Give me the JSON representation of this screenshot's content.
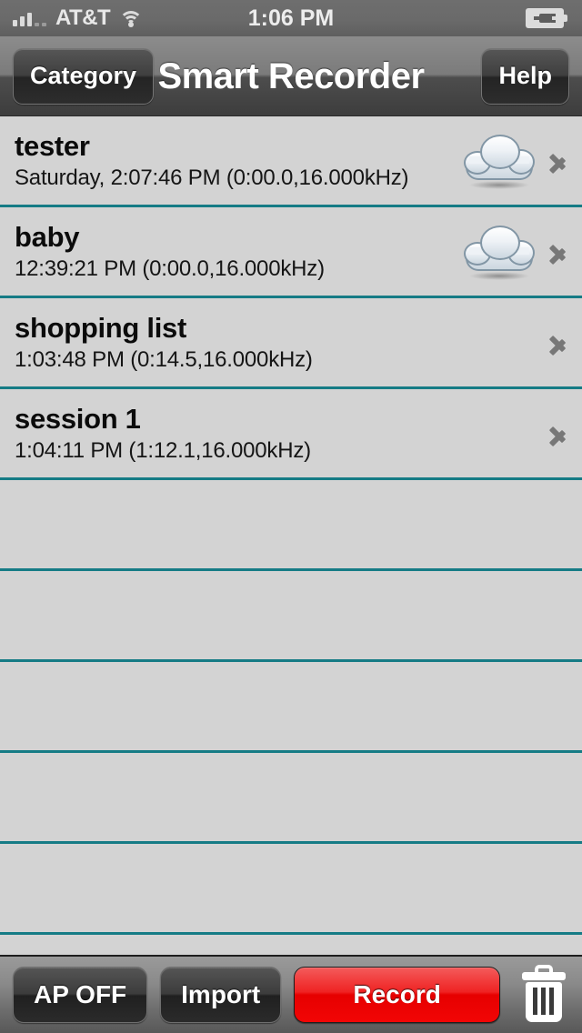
{
  "status_bar": {
    "carrier": "AT&T",
    "time": "1:06 PM",
    "signal_bars_filled": 3,
    "signal_bars_empty": 2,
    "wifi": "wifi-icon",
    "battery": "battery-charging-icon"
  },
  "nav": {
    "left_button": "Category",
    "title": "Smart Recorder",
    "right_button": "Help"
  },
  "list": {
    "separator_color": "#157b85",
    "background": "#d3d3d3",
    "rows": [
      {
        "title": "tester",
        "subtitle": "Saturday, 2:07:46 PM (0:00.0,16.000kHz)",
        "cloud": true,
        "chevron": true
      },
      {
        "title": "baby",
        "subtitle": "12:39:21 PM (0:00.0,16.000kHz)",
        "cloud": true,
        "chevron": true
      },
      {
        "title": "shopping list",
        "subtitle": "1:03:48 PM (0:14.5,16.000kHz)",
        "cloud": false,
        "chevron": true
      },
      {
        "title": "session 1",
        "subtitle": "1:04:11 PM (1:12.1,16.000kHz)",
        "cloud": false,
        "chevron": true
      },
      {
        "title": "",
        "subtitle": "",
        "cloud": false,
        "chevron": false
      },
      {
        "title": "",
        "subtitle": "",
        "cloud": false,
        "chevron": false
      },
      {
        "title": "",
        "subtitle": "",
        "cloud": false,
        "chevron": false
      },
      {
        "title": "",
        "subtitle": "",
        "cloud": false,
        "chevron": false
      },
      {
        "title": "",
        "subtitle": "",
        "cloud": false,
        "chevron": false
      },
      {
        "title": "",
        "subtitle": "",
        "cloud": false,
        "chevron": false
      }
    ]
  },
  "toolbar": {
    "ap_button": "AP OFF",
    "import_button": "Import",
    "record_button": "Record",
    "record_color": "#e60000",
    "delete_icon": "trash-icon"
  }
}
